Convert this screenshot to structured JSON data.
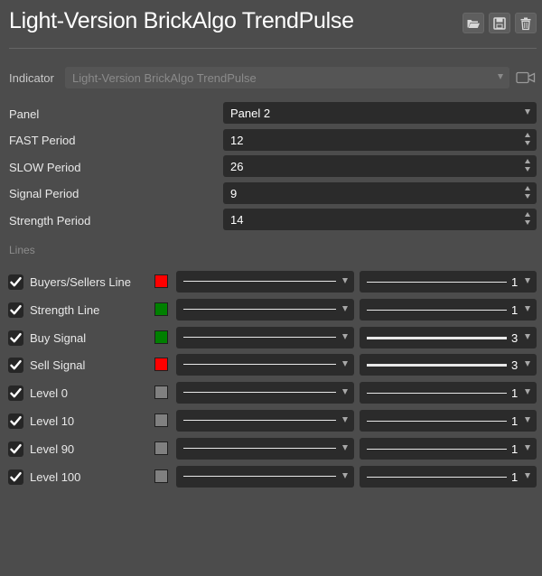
{
  "header": {
    "title": "Light-Version BrickAlgo TrendPulse",
    "buttons": [
      "open-folder-icon",
      "save-icon",
      "trash-icon"
    ]
  },
  "indicator": {
    "label": "Indicator",
    "value": "Light-Version BrickAlgo TrendPulse",
    "camera_icon": "camera-icon"
  },
  "params": [
    {
      "label": "Panel",
      "value": "Panel 2",
      "control": "dropdown"
    },
    {
      "label": "FAST Period",
      "value": "12",
      "control": "stepper"
    },
    {
      "label": "SLOW Period",
      "value": "26",
      "control": "stepper"
    },
    {
      "label": "Signal Period",
      "value": "9",
      "control": "stepper"
    },
    {
      "label": "Strength Period",
      "value": "14",
      "control": "stepper"
    }
  ],
  "lines_section": "Lines",
  "lines": [
    {
      "name": "Buyers/Sellers Line",
      "checked": true,
      "color": "#ff0000",
      "style": "solid",
      "width": "1"
    },
    {
      "name": "Strength Line",
      "checked": true,
      "color": "#008000",
      "style": "solid",
      "width": "1"
    },
    {
      "name": "Buy Signal",
      "checked": true,
      "color": "#008000",
      "style": "solid",
      "width": "3"
    },
    {
      "name": "Sell Signal",
      "checked": true,
      "color": "#ff0000",
      "style": "solid",
      "width": "3"
    },
    {
      "name": "Level 0",
      "checked": true,
      "color": "#808080",
      "style": "solid",
      "width": "1"
    },
    {
      "name": "Level 10",
      "checked": true,
      "color": "#808080",
      "style": "solid",
      "width": "1"
    },
    {
      "name": "Level 90",
      "checked": true,
      "color": "#808080",
      "style": "solid",
      "width": "1"
    },
    {
      "name": "Level 100",
      "checked": true,
      "color": "#808080",
      "style": "solid",
      "width": "1"
    }
  ]
}
